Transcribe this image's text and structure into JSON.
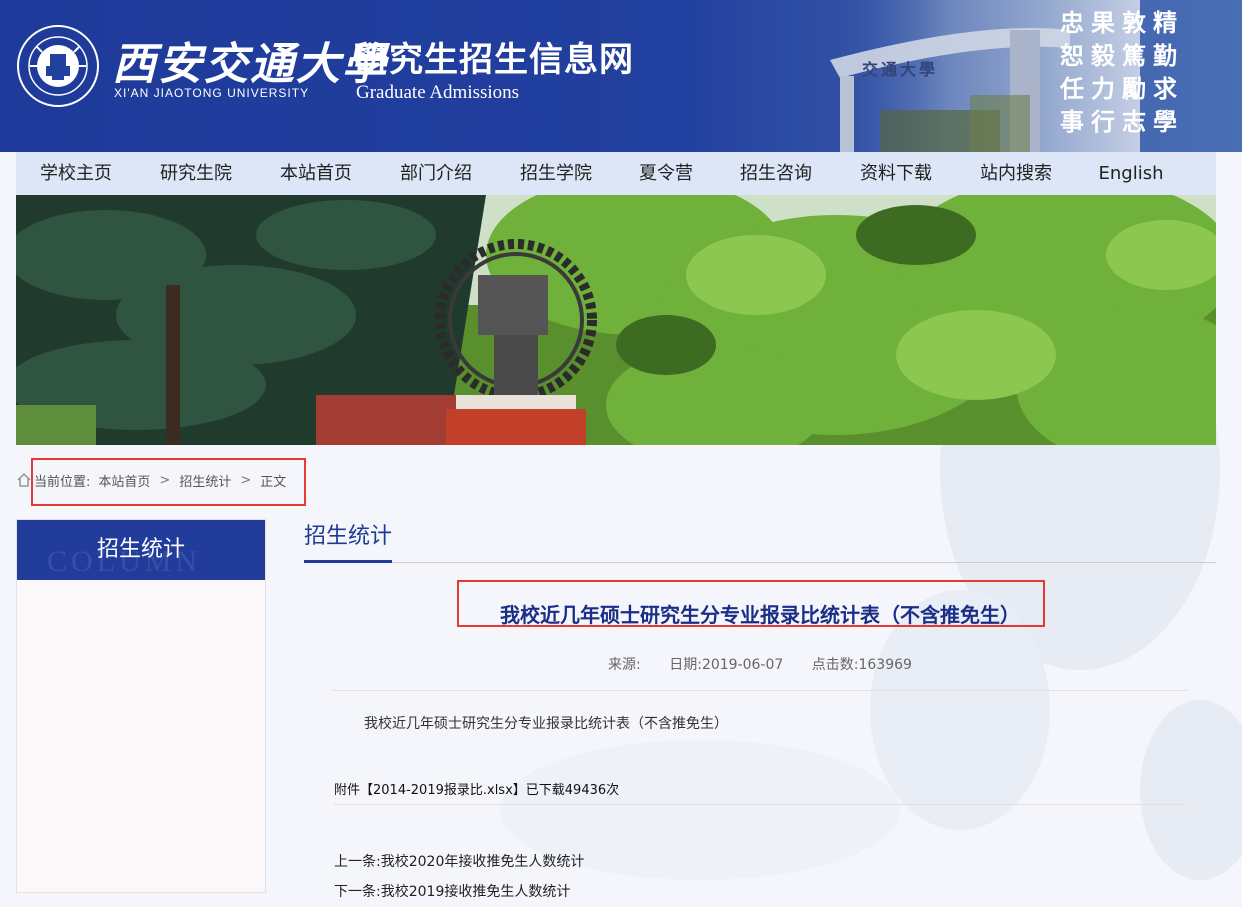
{
  "header": {
    "univ_cn": "西安交通大學",
    "univ_en": "XI'AN JIAOTONG UNIVERSITY",
    "site_cn": "研究生招生信息网",
    "site_en": "Graduate Admissions",
    "motto_lines": [
      "忠果敦精",
      "恕毅篤勤",
      "任力勵求",
      "事行志學"
    ],
    "gate_text": "交通大學"
  },
  "nav": {
    "items": [
      "学校主页",
      "研究生院",
      "本站首页",
      "部门介绍",
      "招生学院",
      "夏令营",
      "招生咨询",
      "资料下载",
      "站内搜索",
      "English"
    ]
  },
  "breadcrumb": {
    "prefix": "当前位置:",
    "items": [
      "本站首页",
      "招生统计",
      "正文"
    ],
    "separator": ">"
  },
  "sidebar": {
    "title": "招生统计",
    "ghost": "COLUMN"
  },
  "main": {
    "section_title": "招生统计",
    "article_title": "我校近几年硕士研究生分专业报录比统计表（不含推免生）",
    "meta": {
      "source_label": "来源:",
      "source_value": "",
      "date_label": "日期:",
      "date_value": "2019-06-07",
      "clicks_label": "点击数:",
      "clicks_value": "163969"
    },
    "body": "我校近几年硕士研究生分专业报录比统计表（不含推免生）",
    "attachment": {
      "prefix": "附件【",
      "filename": "2014-2019报录比.xlsx",
      "suffix": "】已下载49436次"
    },
    "prev": {
      "label": "上一条:",
      "title": "我校2020年接收推免生人数统计"
    },
    "next": {
      "label": "下一条:",
      "title": "我校2019接收推免生人数统计"
    }
  },
  "colors": {
    "header_blue": "#22409f",
    "nav_bg": "#dde6f6",
    "title_blue": "#1a2e87",
    "highlight_red": "#e53935"
  }
}
